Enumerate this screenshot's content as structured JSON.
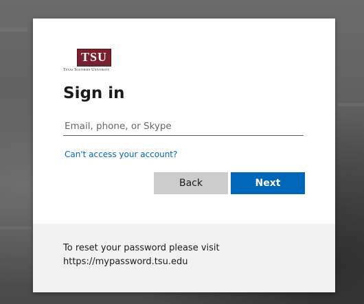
{
  "logo": {
    "mark": "TSU",
    "caption": "Texas Southern University"
  },
  "signin": {
    "title": "Sign in",
    "email_placeholder": "Email, phone, or Skype",
    "email_value": "",
    "help_link": "Can't access your account?"
  },
  "buttons": {
    "back_label": "Back",
    "next_label": "Next"
  },
  "footer": {
    "line1": "To reset your password please visit",
    "line2": "https://mypassword.tsu.edu"
  },
  "colors": {
    "accent": "#0067b8",
    "brand": "#7a1f2b",
    "secondary_button": "#cccccc",
    "footer_bg": "#f2f2f2"
  },
  "icons": {
    "logo": "tsu-logo"
  }
}
